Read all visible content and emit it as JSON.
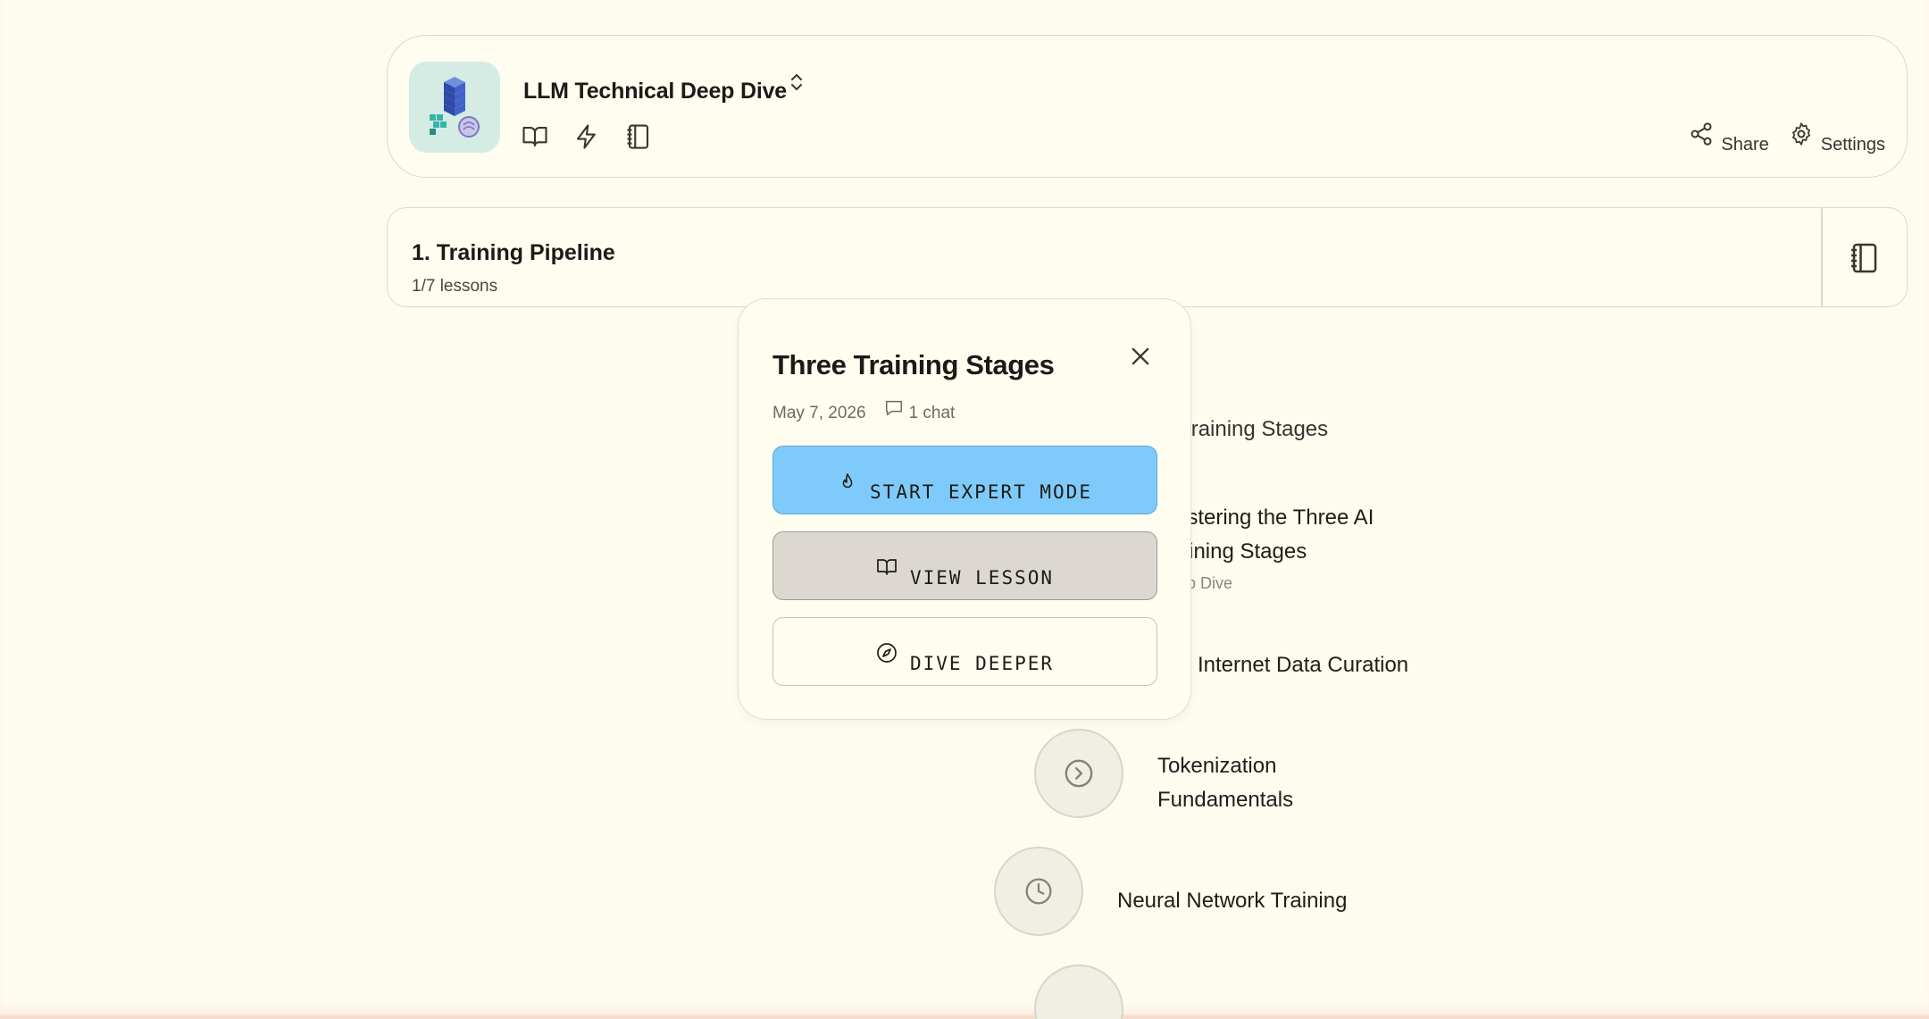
{
  "header": {
    "course_title": "LLM Technical Deep Dive",
    "share_label": "Share",
    "settings_label": "Settings"
  },
  "section": {
    "title": "1. Training Pipeline",
    "progress": "1/7 lessons"
  },
  "path": {
    "lessons": [
      {
        "title": "Three Training Stages",
        "status": "completed"
      },
      {
        "title_line1": "Mastering the Three AI",
        "title_line2": "Training Stages",
        "subtitle": "Deep Dive"
      },
      {
        "title": "Internet Data Curation"
      },
      {
        "title_line1": "Tokenization",
        "title_line2": "Fundamentals",
        "status": "next"
      },
      {
        "title": "Neural Network Training",
        "status": "locked"
      }
    ]
  },
  "popover": {
    "title": "Three Training Stages",
    "date": "May 7, 2026",
    "chat_count": "1 chat",
    "expert_label": "START EXPERT MODE",
    "view_label": "VIEW LESSON",
    "dive_label": "DIVE DEEPER"
  },
  "colors": {
    "background": "#fefbef",
    "expert_button": "#7ecbfb",
    "view_button": "#dcd8d1",
    "logo_bg": "#d5ece4"
  }
}
